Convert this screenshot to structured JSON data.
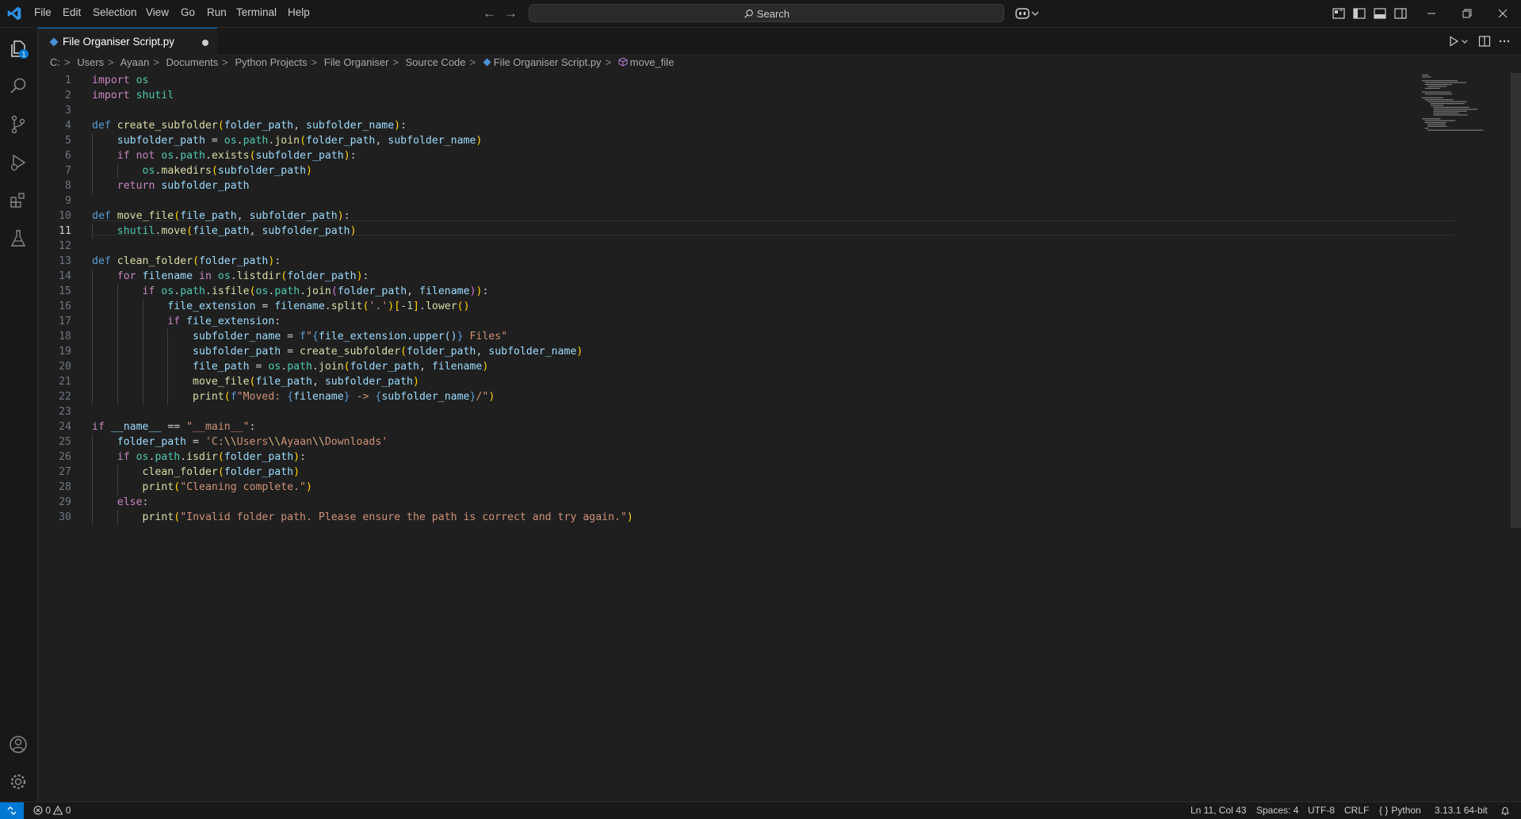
{
  "menu": [
    "File",
    "Edit",
    "Selection",
    "View",
    "Go",
    "Run",
    "Terminal",
    "Help"
  ],
  "search": {
    "label": "Search"
  },
  "tab": {
    "label": "File Organiser Script.py",
    "dirty": true
  },
  "breadcrumb": [
    "C:",
    "Users",
    "Ayaan",
    "Documents",
    "Python Projects",
    "File Organiser",
    "Source Code",
    "File Organiser Script.py",
    "move_file"
  ],
  "explorer_badge": "1",
  "code": {
    "active_line": 11,
    "lines": [
      "import os",
      "import shutil",
      "",
      "def create_subfolder(folder_path, subfolder_name):",
      "    subfolder_path = os.path.join(folder_path, subfolder_name)",
      "    if not os.path.exists(subfolder_path):",
      "        os.makedirs(subfolder_path)",
      "    return subfolder_path",
      "",
      "def move_file(file_path, subfolder_path):",
      "    shutil.move(file_path, subfolder_path)",
      "",
      "def clean_folder(folder_path):",
      "    for filename in os.listdir(folder_path):",
      "        if os.path.isfile(os.path.join(folder_path, filename)):",
      "            file_extension = filename.split('.')[-1].lower()",
      "            if file_extension:",
      "                subfolder_name = f\"{file_extension.upper()} Files\"",
      "                subfolder_path = create_subfolder(folder_path, subfolder_name)",
      "                file_path = os.path.join(folder_path, filename)",
      "                move_file(file_path, subfolder_path)",
      "                print(f\"Moved: {filename} -> {subfolder_name}/\")",
      "",
      "if __name__ == \"__main__\":",
      "    folder_path = 'C:\\\\Users\\\\Ayaan\\\\Downloads'",
      "    if os.path.isdir(folder_path):",
      "        clean_folder(folder_path)",
      "        print(\"Cleaning complete.\")",
      "    else:",
      "        print(\"Invalid folder path. Please ensure the path is correct and try again.\")"
    ]
  },
  "status": {
    "errors": "0",
    "warnings": "0",
    "cursor": "Ln 11, Col 43",
    "spaces": "Spaces: 4",
    "encoding": "UTF-8",
    "eol": "CRLF",
    "language": "Python",
    "interpreter": "3.13.1 64-bit"
  },
  "colors": {
    "accent": "#0078d4",
    "background": "#1f1f1f",
    "chrome": "#181818"
  },
  "icons": [
    "vscode-logo-icon",
    "arrow-left-icon",
    "arrow-right-icon",
    "search-icon",
    "copilot-icon",
    "chevron-down-icon",
    "layout-icon",
    "toggle-primary-sidebar-icon",
    "toggle-panel-icon",
    "toggle-secondary-sidebar-icon",
    "minimize-icon",
    "restore-icon",
    "close-icon",
    "explorer-icon",
    "search-view-icon",
    "source-control-icon",
    "run-debug-icon",
    "extensions-icon",
    "testing-icon",
    "account-icon",
    "manage-gear-icon",
    "python-file-icon",
    "method-icon",
    "run-icon",
    "split-editor-icon",
    "more-actions-icon",
    "remote-icon",
    "error-icon",
    "warning-icon",
    "braces-icon",
    "bell-icon"
  ]
}
